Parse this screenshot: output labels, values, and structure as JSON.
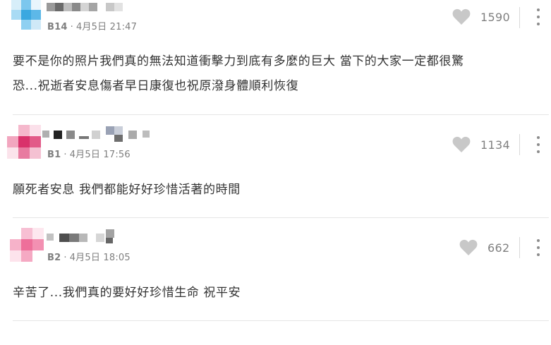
{
  "comments": [
    {
      "floor": "B14",
      "date": "4月5日 21:47",
      "body_line1": "要不是你的照片我們真的無法知道衝擊力到底有多麼的巨大 當下的大家一定都很驚",
      "body_line2": "恐...祝逝者安息傷者早日康復也祝原潑身體順利恢復",
      "likes": "1590"
    },
    {
      "floor": "B1",
      "date": "4月5日 17:56",
      "body_line1": "願死者安息 我們都能好好珍惜活著的時間",
      "likes": "1134"
    },
    {
      "floor": "B2",
      "date": "4月5日 18:05",
      "body_line1": "辛苦了...我們真的要好好珍惜生命 祝平安",
      "likes": "662"
    }
  ],
  "meta_separator": "·",
  "colors": {
    "avatar_1": "#4fb3e6",
    "avatar_2": "#e0457a",
    "avatar_3": "#f07fa8",
    "text": "#333333",
    "meta": "#7f7f7f",
    "heart": "#c8c8c8"
  },
  "icons": {
    "like": "heart-icon",
    "more": "more-vertical-icon"
  }
}
